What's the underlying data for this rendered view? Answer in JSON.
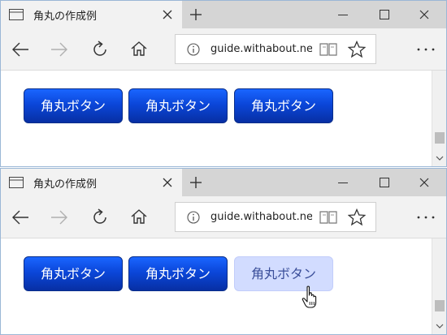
{
  "windows": [
    {
      "tab_title": "角丸の作成例",
      "address": "guide.withabout.net",
      "buttons": [
        "角丸ボタン",
        "角丸ボタン",
        "角丸ボタン"
      ],
      "hover_button": null
    },
    {
      "tab_title": "角丸の作成例",
      "address": "guide.withabout.net",
      "buttons": [
        "角丸ボタン",
        "角丸ボタン",
        "角丸ボタン"
      ],
      "hover_button": 3
    }
  ],
  "icons": {
    "tab_page": "page-icon",
    "tab_close": "close-icon",
    "new_tab": "plus-icon",
    "minimize": "minimize-icon",
    "maximize": "maximize-icon",
    "close": "close-icon",
    "back": "back-arrow-icon",
    "forward": "forward-arrow-icon",
    "refresh": "refresh-icon",
    "home": "home-icon",
    "info": "info-icon",
    "reading_view": "book-icon",
    "favorite": "star-icon",
    "more": "more-dots-icon",
    "cursor": "hand-cursor-icon"
  },
  "colors": {
    "button_gradient_top": "#1a66ff",
    "button_gradient_bottom": "#072fa3",
    "button_hover_bg": "#d2dcff",
    "button_hover_text": "#3b4f9a"
  }
}
